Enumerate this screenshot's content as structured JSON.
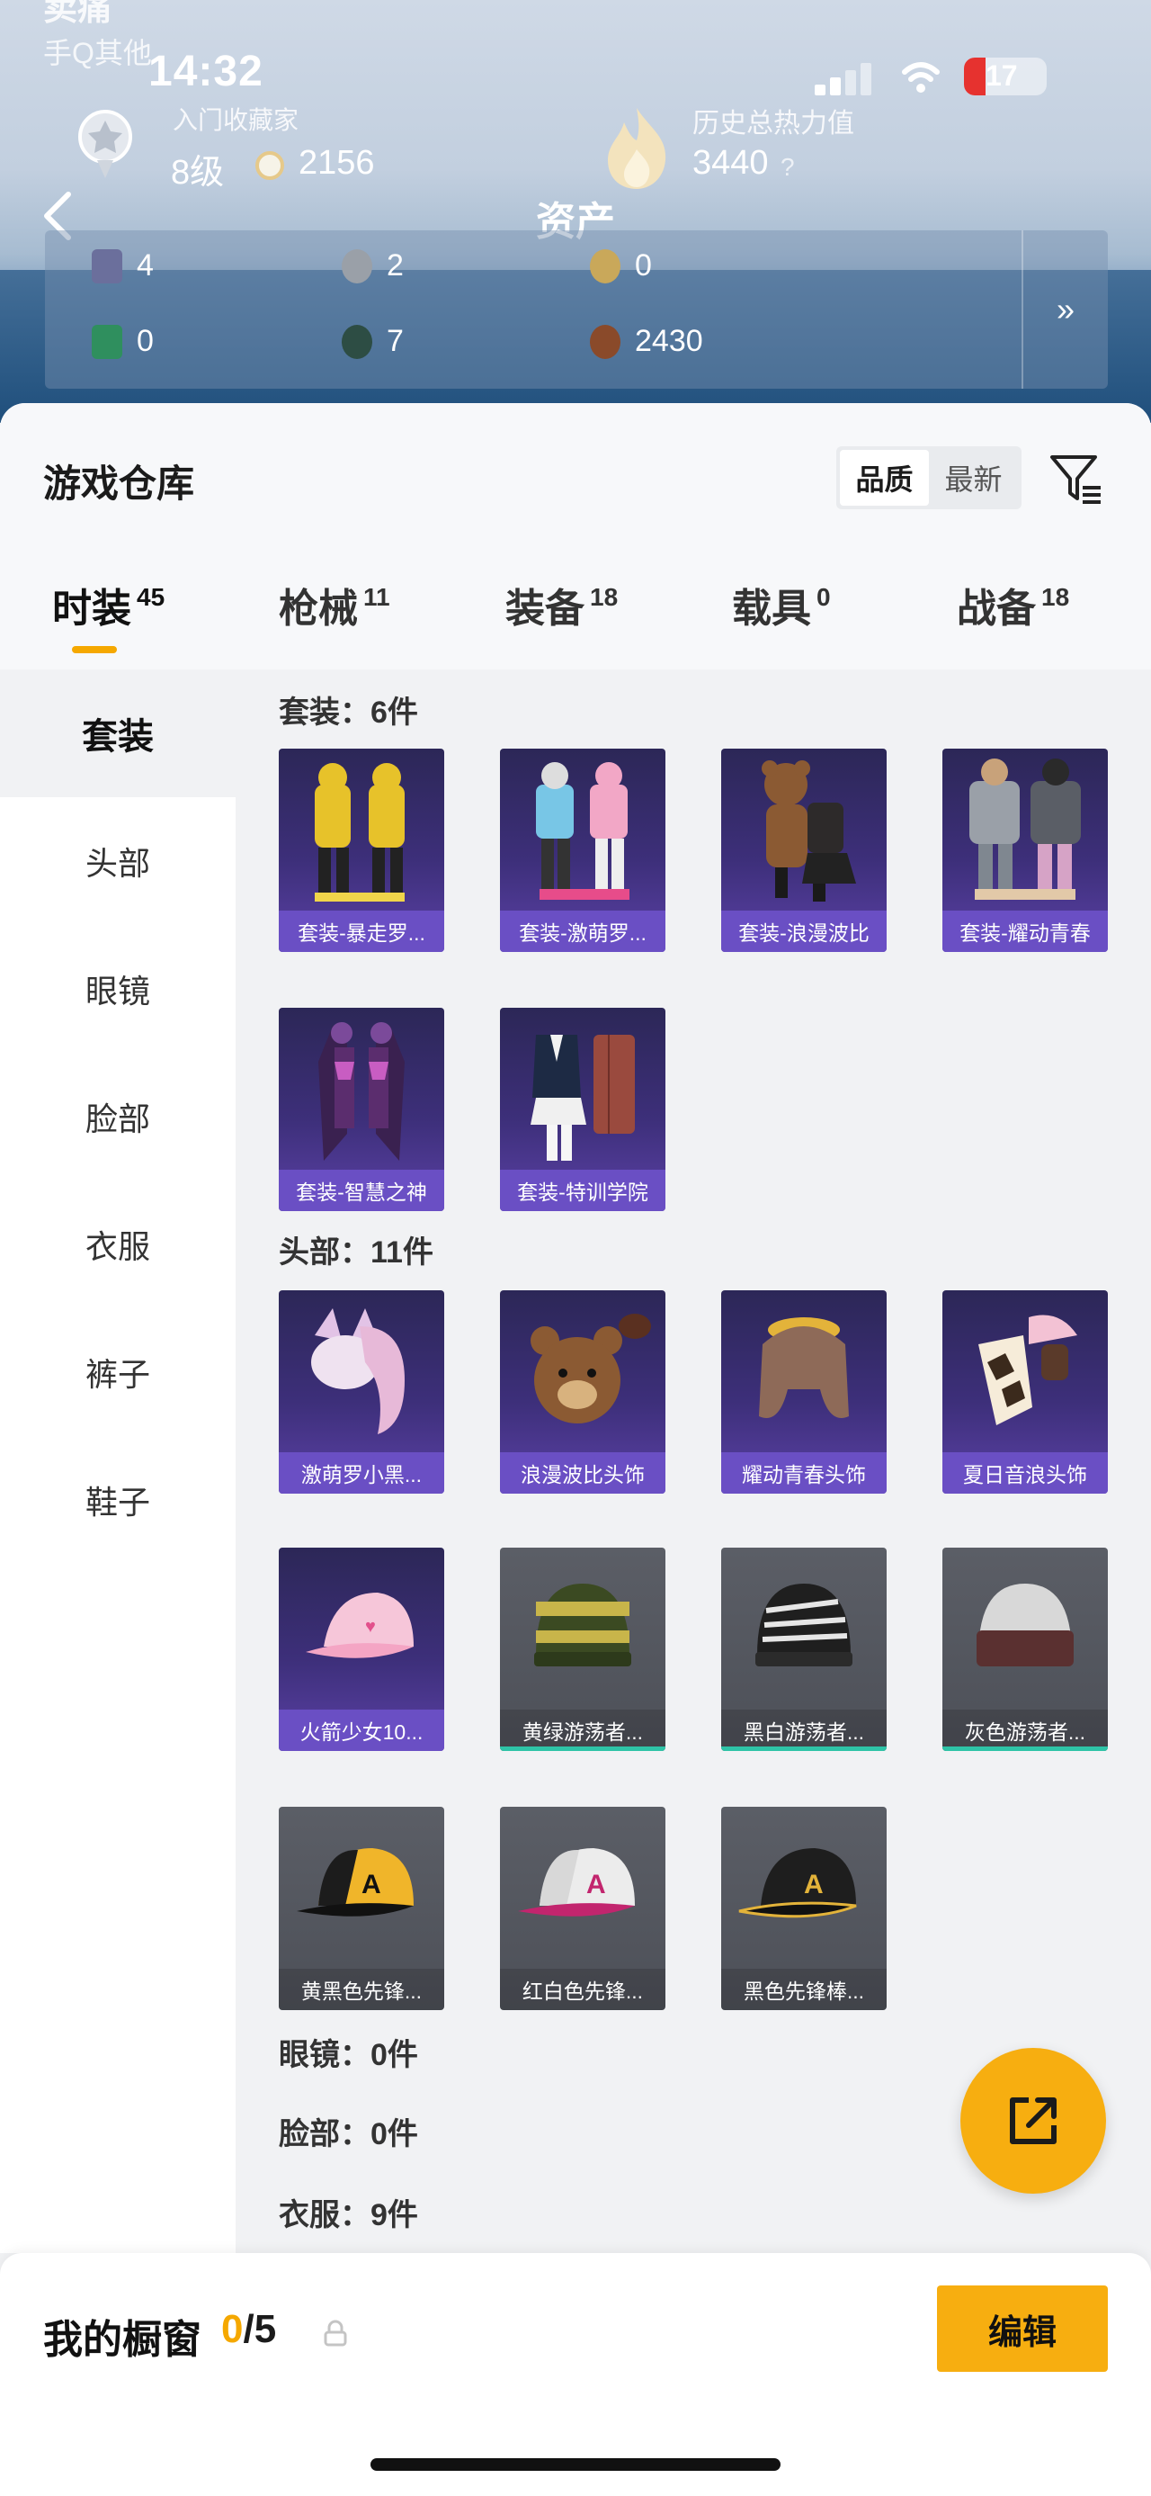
{
  "status": {
    "time": "14:32",
    "battery": "17"
  },
  "player": {
    "name": "卖痛",
    "subtitle": "手Q其他"
  },
  "rank": {
    "title": "入门收藏家",
    "level": "8级",
    "coins": "2156"
  },
  "heat": {
    "title": "历史总热力值",
    "value": "3440",
    "help": "?"
  },
  "assets": {
    "title": "资产",
    "items": [
      {
        "value": "4",
        "icon": "card-icon",
        "color": "#6b6f9c"
      },
      {
        "value": "2",
        "icon": "silver-coin-icon",
        "color": "#9aa0a8"
      },
      {
        "value": "0",
        "icon": "gold-coin-icon",
        "color": "#c9a85a"
      },
      {
        "value": "0",
        "icon": "green-card-icon",
        "color": "#2f8f5e"
      },
      {
        "value": "7",
        "icon": "token-icon",
        "color": "#2d4d44"
      },
      {
        "value": "2430",
        "icon": "bronze-coin-icon",
        "color": "#8a4a2a"
      }
    ],
    "more": "»"
  },
  "warehouse": {
    "title": "游戏仓库",
    "sort": [
      "品质",
      "最新"
    ],
    "tabs": [
      {
        "label": "时装",
        "count": "45"
      },
      {
        "label": "枪械",
        "count": "11"
      },
      {
        "label": "装备",
        "count": "18"
      },
      {
        "label": "载具",
        "count": "0"
      },
      {
        "label": "战备",
        "count": "18"
      }
    ]
  },
  "sidebar": [
    "套装",
    "头部",
    "眼镜",
    "脸部",
    "衣服",
    "裤子",
    "鞋子"
  ],
  "sections": {
    "suits": {
      "label": "套装：6件",
      "items": [
        "套装-暴走罗...",
        "套装-激萌罗...",
        "套装-浪漫波比",
        "套装-耀动青春",
        "套装-智慧之神",
        "套装-特训学院"
      ]
    },
    "head": {
      "label": "头部：11件",
      "items": [
        "激萌罗小黑...",
        "浪漫波比头饰",
        "耀动青春头饰",
        "夏日音浪头饰",
        "火箭少女10...",
        "黄绿游荡者...",
        "黑白游荡者...",
        "灰色游荡者...",
        "黄黑色先锋...",
        "红白色先锋...",
        "黑色先锋棒..."
      ]
    },
    "glasses": {
      "label": "眼镜：0件"
    },
    "face": {
      "label": "脸部：0件"
    },
    "clothes": {
      "label": "衣服：9件"
    }
  },
  "showcase": {
    "title": "我的橱窗",
    "current": "0",
    "total": "/5",
    "edit": "编辑"
  },
  "colors": {
    "accent": "#f7ae10",
    "purple_card": "#5b41a6",
    "gray_card": "#4d5058"
  }
}
